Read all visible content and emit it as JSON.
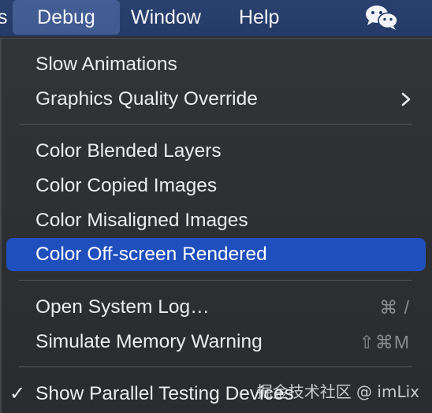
{
  "menubar": {
    "partial_label": "s",
    "items": [
      {
        "label": "Debug"
      },
      {
        "label": "Window"
      },
      {
        "label": "Help"
      }
    ],
    "status_icon": "wechat-icon"
  },
  "menu": {
    "items": [
      {
        "label": "Slow Animations"
      },
      {
        "label": "Graphics Quality Override",
        "has_submenu": true
      },
      {
        "label": "Color Blended Layers"
      },
      {
        "label": "Color Copied Images"
      },
      {
        "label": "Color Misaligned Images"
      },
      {
        "label": "Color Off-screen Rendered",
        "highlighted": true
      },
      {
        "label": "Open System Log…",
        "shortcut": "⌘ /"
      },
      {
        "label": "Simulate Memory Warning",
        "shortcut": "⇧⌘M"
      },
      {
        "label": "Show Parallel Testing Devices",
        "checked": true,
        "check_mark": "✓"
      }
    ]
  },
  "watermark": "掘金技术社区 @ imLix",
  "colors": {
    "menubar_bg": "#253a66",
    "menu_bg": "#2c2e31",
    "highlight": "#1f4fbd",
    "text": "#ececed",
    "shortcut_text": "#8a8c90"
  }
}
